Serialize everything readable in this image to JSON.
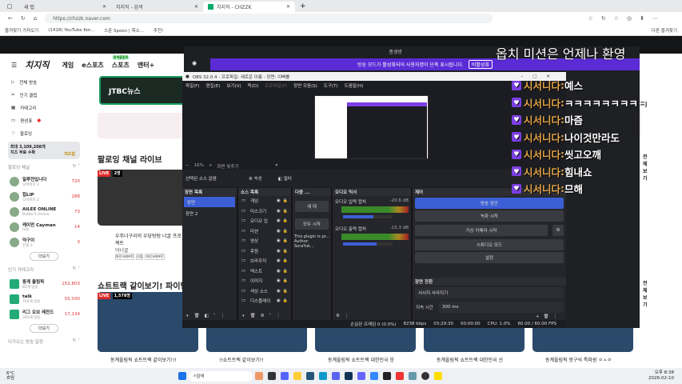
{
  "browser": {
    "tabs": [
      {
        "label": "새 탭"
      },
      {
        "label": "치지직 - 검색"
      },
      {
        "label": "치지직 - CHZZK"
      }
    ],
    "url": "https://chzzk.naver.com",
    "bookmarks": [
      "즐겨찾기 가져오기",
      "(1418) YouTube Kor...",
      "스푼 Spoon | 목소...",
      "추천!"
    ],
    "other_bookmarks": "다른 즐겨찾기"
  },
  "chzzk": {
    "logo": "치지직",
    "nav": [
      "게임",
      "e스포츠",
      "스포츠",
      "엔터+"
    ],
    "nav_badge": "동계올림픽",
    "sidebar": {
      "items": [
        "전체 방송",
        "인기 클립",
        "카테고리",
        "편성표",
        "팔로잉"
      ],
      "promo": "최대 3,109,208개 치즈 무료 수확",
      "promo_label": "치즈칩",
      "following_title": "팔로잉 채널",
      "following": [
        {
          "name": "일루전입니다",
          "sub": "오버워치 2",
          "count": "720"
        },
        {
          "name": "힙LIP",
          "sub": "오버워치 2",
          "count": "288"
        },
        {
          "name": "AILEE ONLINE",
          "sub": "Battle가 Online",
          "count": "73"
        },
        {
          "name": "케이먼 Cayman",
          "sub": "talk",
          "count": "14"
        },
        {
          "name": "덕구이",
          "sub": "인생 3",
          "count": "3"
        }
      ],
      "more": "더보기",
      "popular_title": "인기 카테고리",
      "popular": [
        {
          "name": "동계 올림픽",
          "sub": "82개 방송",
          "count": "152,803"
        },
        {
          "name": "talk",
          "sub": "764개 방송",
          "count": "55,030"
        },
        {
          "name": "리그 오브 레전드",
          "sub": "340개 방송",
          "count": "17,134"
        }
      ],
      "bottom_title": "다가오는 방송 일정"
    },
    "featured": "JTBC뉴스",
    "section1": "팔로잉 채널 라이브",
    "live1_viewers": "2명",
    "live1_title": "우주너구리의 우당탕탕 너굴 프로젝트",
    "live1_channel": "야너굴",
    "live1_tags": [
      "마인크래프트",
      "신입",
      "마인크래프트"
    ],
    "section2": "쇼트트랙 같이보기! 파이팅!",
    "live2_viewers": "1,578명",
    "see_all": "전체보기",
    "bottom_titles": [
      "동계올림픽 쇼트트랙 같이보기!!!",
      "!!쇼트트랙 같이보기!!",
      "동계올림픽 쇼트트랙 대한민국 응",
      "동계올림픽 쇼트트랙 대한민국 선",
      "동계올림픽 방구석 특파원 ㅇㅅㅇ"
    ]
  },
  "discord": {
    "channel": "종경방",
    "banner": "방송 모드가 활성화되어 사용자명이 단축 표시됩니다.",
    "banner_button": "비활성화"
  },
  "overlay_text": "옵치 미션은 언제나 환영",
  "obs": {
    "title": "OBS 32.0.4 - 프로파일: 새로운 이름 - 장면: 이뻐를",
    "menu": [
      "파일(F)",
      "편집(E)",
      "보기(V)",
      "독(D)",
      "프로파일(P)",
      "장면 모음(S)",
      "도구(T)",
      "도움말(H)"
    ],
    "zoom": "16%",
    "fit": "화면 맞추기",
    "no_source": "선택된 소스 없음",
    "properties": "속성",
    "filters": "필터",
    "scenes_title": "장면 목록",
    "scenes": [
      "장면",
      "장면 2"
    ],
    "sources_title": "소스 목록",
    "sources": [
      "게임",
      "미스크기",
      "오디오 입",
      "미션",
      "영상",
      "후원",
      "브라우저",
      "텍스트",
      "이미지",
      "색상 소스",
      "디스플레이"
    ],
    "multi_title": "다중 ...",
    "multi_new": "새 대",
    "multi_start": "모두 시작",
    "multi_text": "This plugin is pr... Author: SoraYuk...",
    "mixer_title": "오디오 믹서",
    "mixer": [
      {
        "name": "오디오 입력 캡처",
        "db": "-20.6 dB",
        "level": 0.62
      },
      {
        "name": "오디오 출력 캡처",
        "db": "-15.3 dB",
        "level": 0.68
      }
    ],
    "controls_title": "제어",
    "controls": [
      "방송 중단",
      "녹화 시작",
      "가상 카메라 시작",
      "스튜디오 모드",
      "설정"
    ],
    "transition_title": "장면 전환",
    "transition": "서서히 사라지기",
    "duration_label": "지속 시간",
    "duration": "300 ms",
    "status": {
      "dropped": "손실된 프레임 0 (0.0%)",
      "bitrate": "8238 kbps",
      "live_time": "03:29:30",
      "rec_time": "00:00:00",
      "cpu": "CPU: 1.0%",
      "fps": "60.00 / 60.00 FPS"
    }
  },
  "chat": [
    {
      "nick": "시서니다",
      "msg": "예스"
    },
    {
      "nick": "시서니다",
      "msg": "ㅋㅋㅋㅋㅋㅋㅋㅋㅋ"
    },
    {
      "nick": "시서니다",
      "msg": "마즘"
    },
    {
      "nick": "시서니다",
      "msg": "나이것만라도"
    },
    {
      "nick": "시서니다",
      "msg": "씻고오깨"
    },
    {
      "nick": "시서니다",
      "msg": "힘내쇼"
    },
    {
      "nick": "시서니다",
      "msg": "므해"
    }
  ],
  "taskbar": {
    "weather": "6°C",
    "weather_sub": "흐림",
    "search": "검색",
    "time": "오후 8:38",
    "date": "2026-02-10"
  }
}
